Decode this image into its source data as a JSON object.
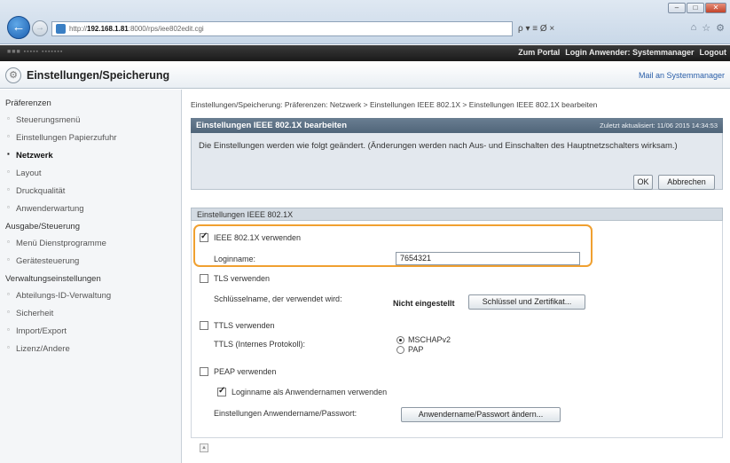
{
  "browser": {
    "url_prefix": "http://",
    "url_host": "192.168.1.81",
    "url_path": ":8000/rps/iee802edit.cgi",
    "search_glyphs": "ρ ▾ ≡ Ø ×",
    "window_buttons": [
      "–",
      "□",
      "✕"
    ]
  },
  "portal": {
    "portal_link": "Zum Portal",
    "login_link": "Login Anwender: Systemmanager",
    "logout_link": "Logout"
  },
  "header": {
    "title": "Einstellungen/Speicherung",
    "mail_link": "Mail an Systemmanager"
  },
  "sidebar": {
    "section1": "Präferenzen",
    "items1": [
      "Steuerungsmenü",
      "Einstellungen Papierzufuhr",
      "Netzwerk",
      "Layout",
      "Druckqualität",
      "Anwenderwartung"
    ],
    "section2": "Ausgabe/Steuerung",
    "items2": [
      "Menü Dienstprogramme",
      "Gerätesteuerung"
    ],
    "section3": "Verwaltungseinstellungen",
    "items3": [
      "Abteilungs-ID-Verwaltung",
      "Sicherheit",
      "Import/Export",
      "Lizenz/Andere"
    ]
  },
  "main": {
    "breadcrumb": "Einstellungen/Speicherung: Präferenzen: Netzwerk > Einstellungen IEEE 802.1X > Einstellungen IEEE 802.1X bearbeiten",
    "panel_title": "Einstellungen IEEE 802.1X bearbeiten",
    "last_updated": "Zuletzt aktualisiert: 11/06 2015 14:34:53",
    "notice": "Die Einstellungen werden wie folgt geändert. (Änderungen werden nach Aus- und Einschalten des Hauptnetzschalters wirksam.)",
    "ok_label": "OK",
    "cancel_label": "Abbrechen",
    "section_title": "Einstellungen IEEE 802.1X",
    "use_ieee_label": "IEEE 802.1X verwenden",
    "use_ieee_checked": true,
    "login_name_label": "Loginname:",
    "login_name_value": "7654321",
    "tls_label": "TLS verwenden",
    "tls_checked": false,
    "key_name_label": "Schlüsselname, der verwendet wird:",
    "key_status": "Nicht eingestellt",
    "key_button": "Schlüssel und Zertifikat...",
    "ttls_label": "TTLS verwenden",
    "ttls_checked": false,
    "ttls_protocol_label": "TTLS (Internes Protokoll):",
    "ttls_options": [
      "MSCHAPv2",
      "PAP"
    ],
    "ttls_selected": "MSCHAPv2",
    "peap_label": "PEAP verwenden",
    "peap_checked": false,
    "use_login_as_user_label": "Loginname als Anwendernamen verwenden",
    "use_login_as_user_checked": true,
    "user_pw_label": "Einstellungen Anwendername/Passwort:",
    "user_pw_button": "Anwendername/Passwort ändern..."
  },
  "colors": {
    "highlight": "#f0a030",
    "panel_header": "#5a6f84",
    "link": "#2a5ea8"
  }
}
